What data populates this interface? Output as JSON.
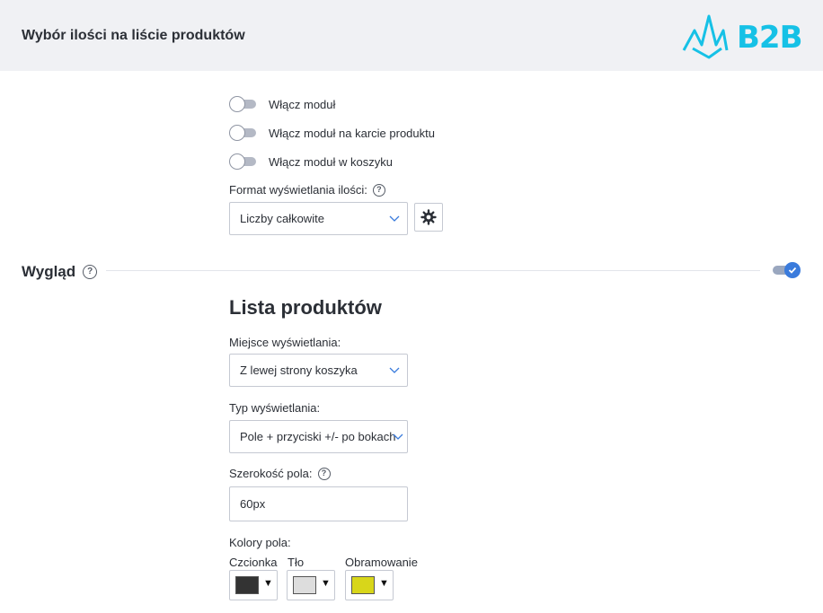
{
  "header": {
    "title": "Wybór ilości na liście produktów",
    "logo_text": "B2B"
  },
  "toggles": [
    {
      "label": "Włącz moduł",
      "on": false
    },
    {
      "label": "Włącz moduł na karcie produktu",
      "on": false
    },
    {
      "label": "Włącz moduł w koszyku",
      "on": false
    }
  ],
  "format": {
    "label": "Format wyświetlania ilości:",
    "value": "Liczby całkowite"
  },
  "section": {
    "title": "Wygląd",
    "enabled": true
  },
  "list": {
    "heading": "Lista produktów",
    "placement_label": "Miejsce wyświetlania:",
    "placement_value": "Z lewej strony koszyka",
    "type_label": "Typ wyświetlania:",
    "type_value": "Pole + przyciski +/- po bokach",
    "width_label": "Szerokość pola:",
    "width_value": "60px",
    "colors_label": "Kolory pola:",
    "colors": [
      {
        "label": "Czcionka",
        "color": "#333333"
      },
      {
        "label": "Tło",
        "color": "#dddddd"
      },
      {
        "label": "Obramowanie",
        "color": "#d8d61a"
      }
    ]
  },
  "theme": {
    "accent": "#3a7bdc",
    "logo": "#16c1e6"
  }
}
